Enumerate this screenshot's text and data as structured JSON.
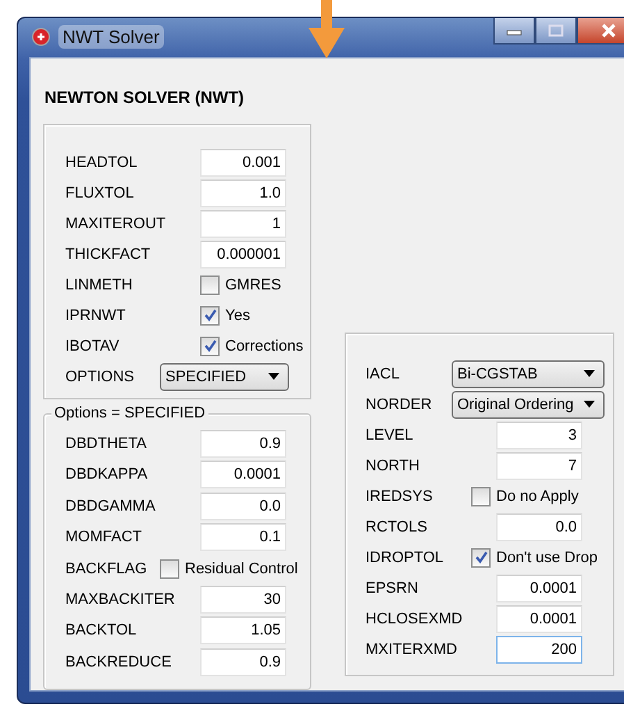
{
  "window": {
    "title": "NWT Solver"
  },
  "heading": "NEWTON SOLVER (NWT)",
  "main_panel": {
    "rows": [
      {
        "kind": "field",
        "label": "HEADTOL",
        "value": "0.001",
        "focused": false
      },
      {
        "kind": "field",
        "label": "FLUXTOL",
        "value": "1.0",
        "focused": false
      },
      {
        "kind": "field",
        "label": "MAXITEROUT",
        "value": "1",
        "focused": false
      },
      {
        "kind": "field",
        "label": "THICKFACT",
        "value": "0.000001",
        "focused": false
      },
      {
        "kind": "checkbox",
        "label": "LINMETH",
        "option": "GMRES",
        "checked": false
      },
      {
        "kind": "checkbox",
        "label": "IPRNWT",
        "option": "Yes",
        "checked": true
      },
      {
        "kind": "checkbox",
        "label": "IBOTAV",
        "option": "Corrections",
        "checked": true
      },
      {
        "kind": "dropdown",
        "label": "OPTIONS",
        "value": "SPECIFIED"
      }
    ]
  },
  "options_panel": {
    "legend": "Options = SPECIFIED",
    "rows": [
      {
        "kind": "field",
        "label": "DBDTHETA",
        "value": "0.9",
        "focused": false
      },
      {
        "kind": "field",
        "label": "DBDKAPPA",
        "value": "0.0001",
        "focused": false
      },
      {
        "kind": "field",
        "label": "DBDGAMMA",
        "value": "0.0",
        "focused": false
      },
      {
        "kind": "field",
        "label": "MOMFACT",
        "value": "0.1",
        "focused": false
      },
      {
        "kind": "checkbox",
        "label": "BACKFLAG",
        "option": "Residual Control",
        "checked": false
      },
      {
        "kind": "field",
        "label": "MAXBACKITER",
        "value": "30",
        "focused": false
      },
      {
        "kind": "field",
        "label": "BACKTOL",
        "value": "1.05",
        "focused": false
      },
      {
        "kind": "field",
        "label": "BACKREDUCE",
        "value": "0.9",
        "focused": false
      }
    ]
  },
  "solver_panel": {
    "rows": [
      {
        "kind": "dropdown",
        "label": "IACL",
        "value": "Bi-CGSTAB"
      },
      {
        "kind": "dropdown",
        "label": "NORDER",
        "value": "Original Ordering"
      },
      {
        "kind": "field",
        "label": "LEVEL",
        "value": "3",
        "focused": false
      },
      {
        "kind": "field",
        "label": "NORTH",
        "value": "7",
        "focused": false
      },
      {
        "kind": "checkbox",
        "label": "IREDSYS",
        "option": "Do no Apply",
        "checked": false
      },
      {
        "kind": "field",
        "label": "RCTOLS",
        "value": "0.0",
        "focused": false
      },
      {
        "kind": "checkbox",
        "label": "IDROPTOL",
        "option": "Don't use Drop",
        "checked": true
      },
      {
        "kind": "field",
        "label": "EPSRN",
        "value": "0.0001",
        "focused": false
      },
      {
        "kind": "field",
        "label": "HCLOSEXMD",
        "value": "0.0001",
        "focused": false
      },
      {
        "kind": "field",
        "label": "MXITERXMD",
        "value": "200",
        "focused": true
      }
    ]
  }
}
